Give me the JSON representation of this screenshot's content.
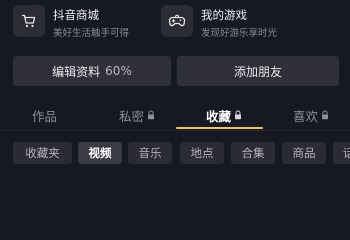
{
  "features": [
    {
      "title": "抖音商城",
      "subtitle": "美好生活触手可得",
      "icon": "cart-icon"
    },
    {
      "title": "我的游戏",
      "subtitle": "发现好游乐享时光",
      "icon": "gamepad-icon"
    }
  ],
  "buttons": {
    "edit_profile": "编辑资料",
    "edit_progress": "60%",
    "add_friend": "添加朋友"
  },
  "tabs": [
    {
      "label": "作品",
      "locked": false
    },
    {
      "label": "私密",
      "locked": true
    },
    {
      "label": "收藏",
      "locked": true,
      "active": true
    },
    {
      "label": "喜欢",
      "locked": true
    }
  ],
  "subtabs": [
    {
      "label": "收藏夹"
    },
    {
      "label": "视频",
      "active": true
    },
    {
      "label": "音乐"
    },
    {
      "label": "地点"
    },
    {
      "label": "合集"
    },
    {
      "label": "商品"
    },
    {
      "label": "话"
    }
  ],
  "colors": {
    "background": "#161823",
    "accent": "#f2c744",
    "chip": "#2a2b33"
  }
}
